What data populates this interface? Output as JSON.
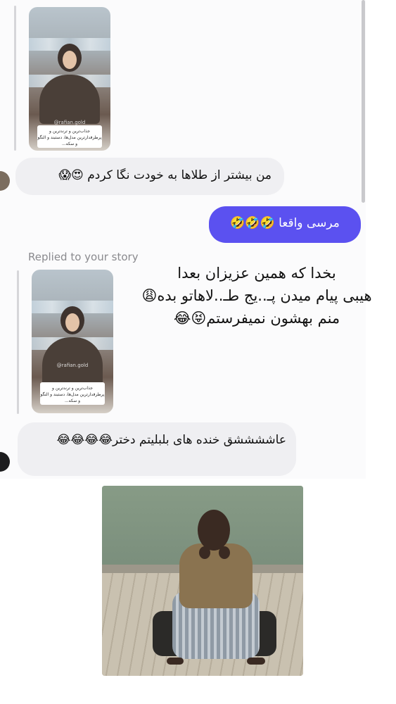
{
  "colors": {
    "outgoing_bubble": "#5b51f0",
    "incoming_bubble": "#efeff2",
    "replied_label": "#8a8a8e",
    "thread_background": "#fbfbfc"
  },
  "messages": {
    "story_reply_1": {
      "story_caption": "جذاب‌ترین و ترند‌ترین و پرطرفدارترین مدل‌ها، دستبند و النگو و سکه...",
      "story_watermark": "@rafian.gold",
      "text": "من بیشتر از طلاها به خودت نگا کردم 😍😱"
    },
    "outgoing_1": {
      "text": "مرسی واقعا 🤣🤣🤣"
    },
    "story_reply_2": {
      "replied_label": "Replied to your story",
      "story_caption": "جذاب‌ترین و ترند‌ترین و پرطرفدارترین مدل‌ها، دستبند و النگو و سکه...",
      "story_watermark": "@rafian.gold",
      "text": "عاششششق خنده های بلبلیتم دختر😂😂😂😂"
    }
  },
  "overlay_caption": {
    "line1": "بخدا که همین عزیزان بعدا",
    "line2": "هیبی پیام میدن پـ..یج طـ..لاهاتو بده😩",
    "line3": "منم بهشون نمیفرستم😝😂"
  },
  "meme_image": {
    "icon": "sad-boy-sitting-on-tire-photo"
  }
}
